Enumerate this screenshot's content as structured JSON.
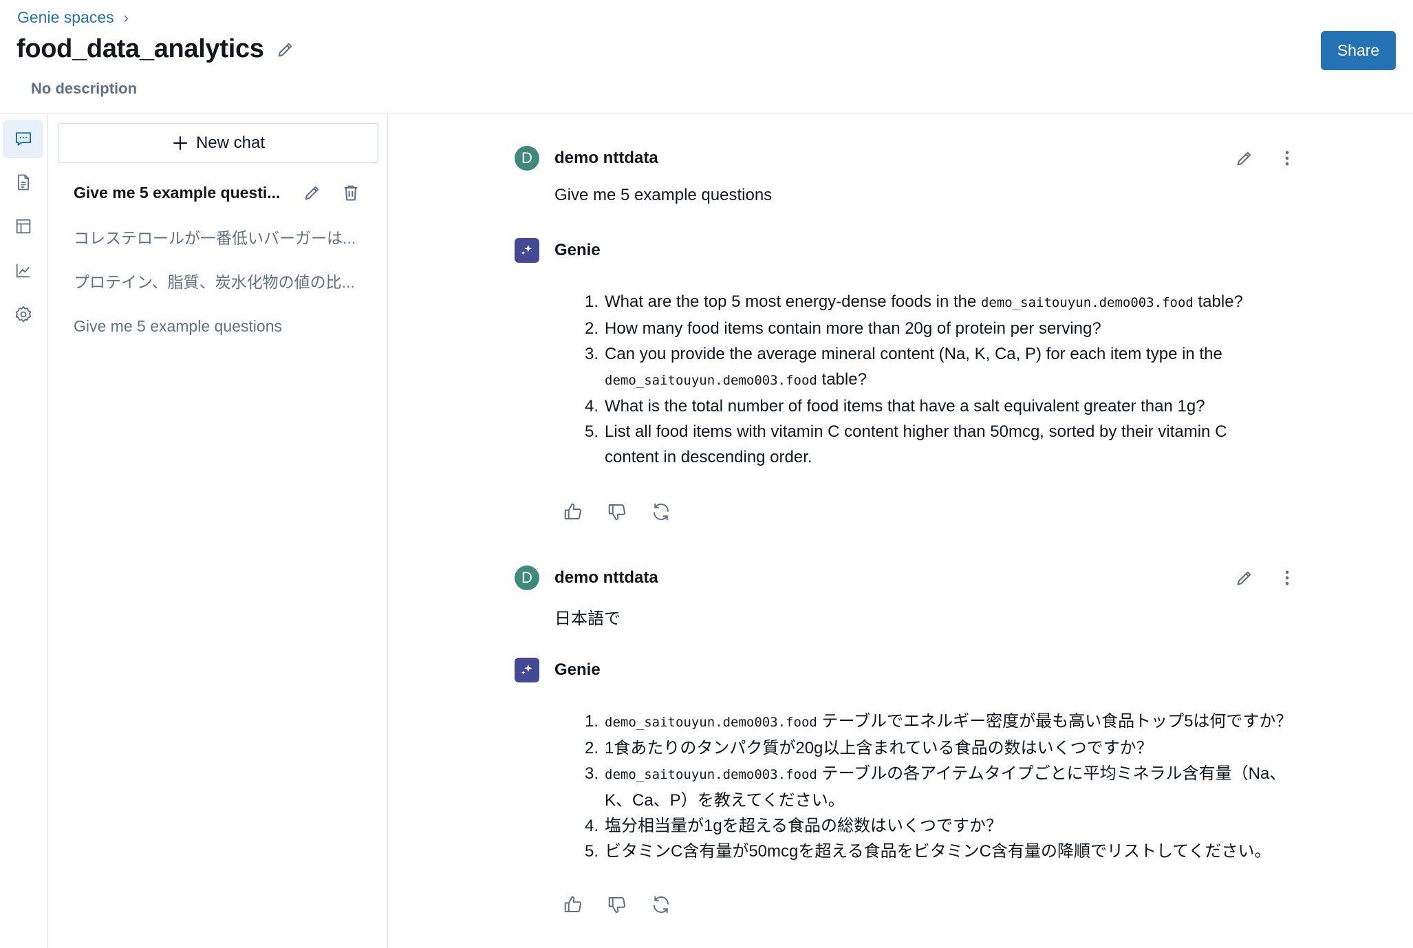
{
  "header": {
    "breadcrumb": "Genie spaces",
    "title": "food_data_analytics",
    "description": "No description",
    "share_label": "Share"
  },
  "rail": {
    "items": [
      "chat-icon",
      "document-icon",
      "table-icon",
      "chart-icon",
      "settings-icon"
    ]
  },
  "chatlist": {
    "new_chat_label": "New chat",
    "items": [
      "Give me 5 example questi...",
      "コレステロールが一番低いバーガーは...",
      "プロテイン、脂質、炭水化物の値の比...",
      "Give me 5 example questions"
    ]
  },
  "conversation": {
    "messages": [
      {
        "author": "demo nttdata",
        "avatar_letter": "D",
        "text": "Give me 5 example questions"
      },
      {
        "author": "Genie",
        "items": [
          {
            "num": "1.",
            "pre": "What are the top 5 most energy-dense foods in the ",
            "code": "demo_saitouyun.demo003.food",
            "post": " table?"
          },
          {
            "num": "2.",
            "text": "How many food items contain more than 20g of protein per serving?"
          },
          {
            "num": "3.",
            "pre": "Can you provide the average mineral content (Na, K, Ca, P) for each item type in the",
            "code": "demo_saitouyun.demo003.food",
            "post": " table?"
          },
          {
            "num": "4.",
            "text": "What is the total number of food items that have a salt equivalent greater than 1g?"
          },
          {
            "num": "5.",
            "line1": "List all food items with vitamin C content higher than 50mcg, sorted by their vitamin C",
            "line2": "content in descending order."
          }
        ]
      },
      {
        "author": "demo nttdata",
        "avatar_letter": "D",
        "text": "日本語で"
      },
      {
        "author": "Genie",
        "items": [
          {
            "num": "1.",
            "code": "demo_saitouyun.demo003.food",
            "post": " テーブルでエネルギー密度が最も高い食品トップ5は何ですか？"
          },
          {
            "num": "2.",
            "text": "1食あたりのタンパク質が20g以上含まれている食品の数はいくつですか？"
          },
          {
            "num": "3.",
            "code": "demo_saitouyun.demo003.food",
            "post": " テーブルの各アイテムタイプごとに平均ミネラル含有量（Na、",
            "line2": "K、Ca、P）を教えてください。"
          },
          {
            "num": "4.",
            "text": "塩分相当量が1gを超える食品の総数はいくつですか？"
          },
          {
            "num": "5.",
            "text": "ビタミンC含有量が50mcgを超える食品をビタミンC含有量の降順でリストしてください。"
          }
        ]
      }
    ]
  },
  "colors": {
    "accent": "#2272b4",
    "user_avatar": "#3f8a7b",
    "genie_avatar": "#434a93",
    "muted_text": "#5f7281",
    "border": "#e0e3e6"
  }
}
